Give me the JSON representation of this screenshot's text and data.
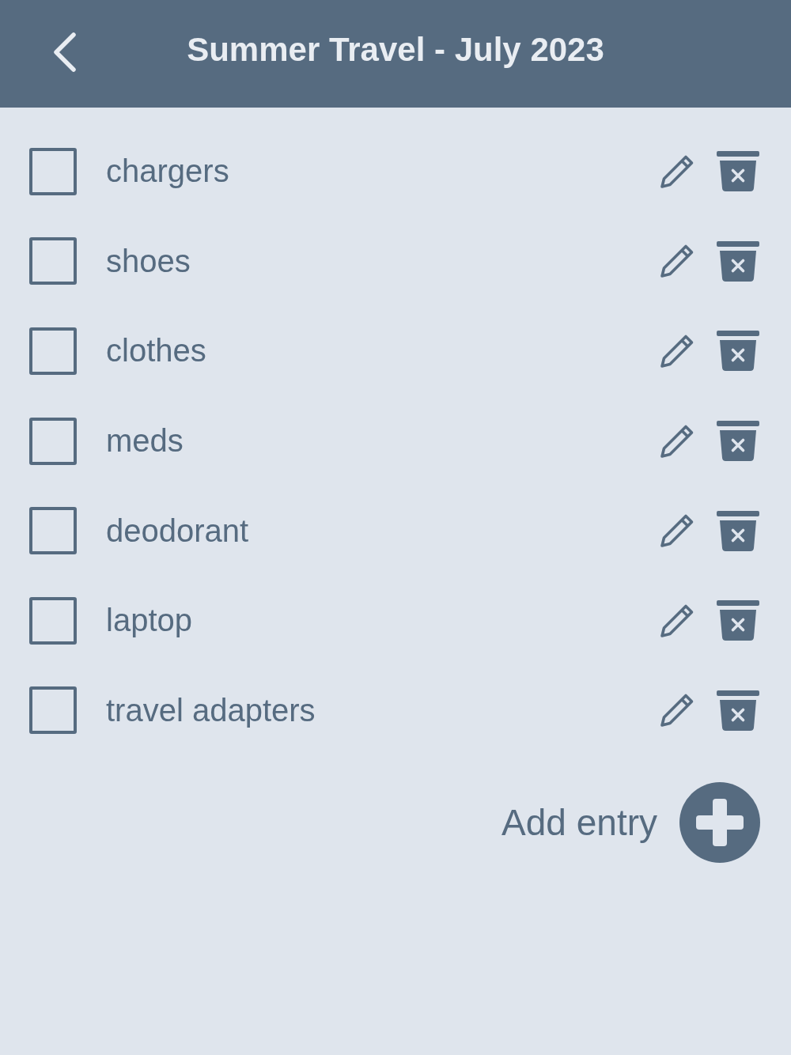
{
  "header": {
    "title": "Summer Travel - July 2023"
  },
  "items": [
    {
      "label": "chargers",
      "checked": false
    },
    {
      "label": "shoes",
      "checked": false
    },
    {
      "label": "clothes",
      "checked": false
    },
    {
      "label": "meds",
      "checked": false
    },
    {
      "label": "deodorant",
      "checked": false
    },
    {
      "label": "laptop",
      "checked": false
    },
    {
      "label": "travel adapters",
      "checked": false
    }
  ],
  "add_button": {
    "label": "Add entry"
  }
}
